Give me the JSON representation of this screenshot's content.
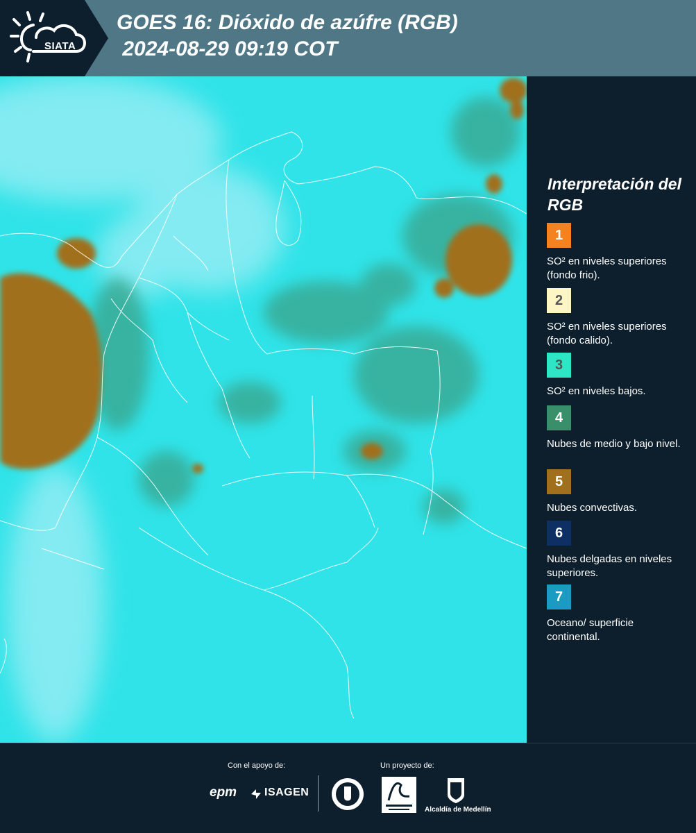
{
  "header": {
    "logo_text": "SIATA",
    "title_line1": "GOES 16: Dióxido de azúfre (RGB)",
    "title_line2": " 2024-08-29 09:19 COT"
  },
  "legend": {
    "title": "Interpretación del RGB",
    "items": [
      {
        "num": "1",
        "label": "SO² en niveles superiores (fondo frio).",
        "color": "#f58220",
        "text_color": "#ffffff"
      },
      {
        "num": "2",
        "label": "SO² en niveles superiores (fondo calido).",
        "color": "#fdf5c4",
        "text_color": "#555555"
      },
      {
        "num": "3",
        "label": "SO² en niveles bajos.",
        "color": "#2ee6c6",
        "text_color": "#555555"
      },
      {
        "num": "4",
        "label": "Nubes de medio y bajo nivel.",
        "color": "#3a8f6b",
        "text_color": "#ffffff"
      },
      {
        "num": "5",
        "label": "Nubes convectivas.",
        "color": "#a0701c",
        "text_color": "#ffffff"
      },
      {
        "num": "6",
        "label": "Nubes delgadas en niveles superiores.",
        "color": "#0e2f63",
        "text_color": "#ffffff"
      },
      {
        "num": "7",
        "label": "Oceano/ superficie continental.",
        "color": "#1a9bc2",
        "text_color": "#ffffff"
      }
    ]
  },
  "footer": {
    "support_label": "Con el apoyo de:",
    "project_label": "Un proyecto de:",
    "sponsor_1": "epm",
    "sponsor_2": "ISAGEN",
    "partner_3": "Alcaldía de Medellín"
  },
  "colors": {
    "background": "#0d1f2d",
    "header_band": "#4f7786",
    "map_cyan": "#2fe3e8",
    "convective_brown": "#a0701c",
    "cloud_green": "#3a8f6b"
  }
}
